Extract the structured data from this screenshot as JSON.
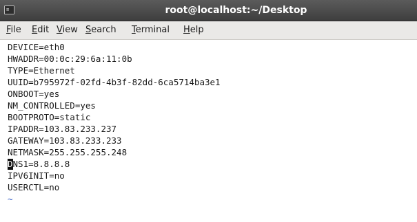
{
  "window": {
    "title": "root@localhost:~/Desktop",
    "icon_glyph": "≡"
  },
  "menu": {
    "file": {
      "first": "F",
      "rest": "ile"
    },
    "edit": {
      "first": "E",
      "rest": "dit"
    },
    "view": {
      "first": "V",
      "rest": "iew"
    },
    "search": {
      "first": "S",
      "rest": "earch"
    },
    "terminal": {
      "first": "T",
      "rest": "erminal"
    },
    "help": {
      "first": "H",
      "rest": "elp"
    }
  },
  "terminal": {
    "lines": [
      "DEVICE=eth0",
      "HWADDR=00:0c:29:6a:11:0b",
      "TYPE=Ethernet",
      "UUID=b795972f-02fd-4b3f-82dd-6ca5714ba3e1",
      "ONBOOT=yes",
      "NM_CONTROLLED=yes",
      "BOOTPROTO=static",
      "IPADDR=103.83.233.237",
      "GATEWAY=103.83.233.233",
      "NETMASK=255.255.255.248"
    ],
    "cursor_char": "D",
    "cursor_line_rest": "NS1=8.8.8.8",
    "lines_after": [
      "IPV6INIT=no",
      "USERCTL=no"
    ],
    "empty_line_marker": "~"
  },
  "colors": {
    "titlebar": "#4a4a4a",
    "menubar": "#eae9e7",
    "tilde": "#3b63c9"
  }
}
